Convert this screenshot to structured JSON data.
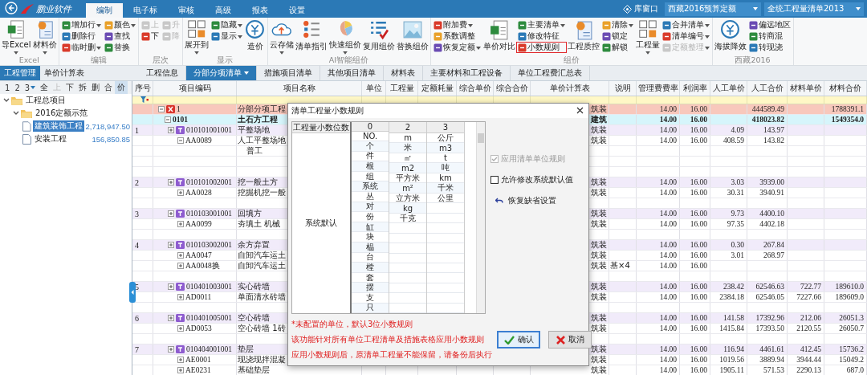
{
  "app": {
    "logo": "鹏业软件",
    "tabs": [
      {
        "label": "编制",
        "selected": true
      },
      {
        "label": "电子标",
        "selected": false
      },
      {
        "label": "审核",
        "selected": false
      },
      {
        "label": "高级",
        "selected": false
      },
      {
        "label": "报表",
        "selected": false
      },
      {
        "label": "设置",
        "selected": false
      }
    ],
    "library_button": "库窗口",
    "quota_select": {
      "value": "西藏2016预算定额"
    },
    "bill_select": {
      "value": "全统工程量清单2013"
    }
  },
  "ribbon": {
    "groups": [
      {
        "label": "Excel",
        "columns": [
          {
            "kind": "large",
            "label": "导Excel",
            "caret": true
          },
          {
            "kind": "large",
            "label": "材料价",
            "caret": true
          }
        ]
      },
      {
        "label": "编辑",
        "columns": [
          {
            "kind": "stack",
            "items": [
              {
                "label": "增加行",
                "caret": true,
                "kind": "normal"
              },
              {
                "label": "删除行",
                "caret": false,
                "kind": "normal"
              },
              {
                "label": "临时删",
                "caret": true,
                "kind": "normal"
              }
            ]
          },
          {
            "kind": "stack",
            "items": [
              {
                "label": "颜色",
                "caret": true,
                "kind": "normal"
              },
              {
                "label": "查找",
                "caret": false,
                "kind": "normal"
              },
              {
                "label": "替换",
                "caret": false,
                "kind": "normal"
              }
            ]
          }
        ]
      },
      {
        "label": "层次",
        "columns": [
          {
            "kind": "stack",
            "items": [
              {
                "label": "上",
                "caret": false,
                "kind": "disabled"
              },
              {
                "label": "下",
                "caret": false,
                "kind": "normal"
              }
            ]
          },
          {
            "kind": "stack",
            "items": [
              {
                "label": "升",
                "caret": false,
                "kind": "disabled"
              },
              {
                "label": "降",
                "caret": false,
                "kind": "disabled"
              }
            ]
          }
        ]
      },
      {
        "label": "显示",
        "columns": [
          {
            "kind": "large",
            "label": "展开到",
            "caret": true
          },
          {
            "kind": "stack",
            "items": [
              {
                "label": "隐藏",
                "caret": true,
                "kind": "normal"
              },
              {
                "label": "显示",
                "caret": true,
                "kind": "normal"
              }
            ]
          },
          {
            "kind": "large",
            "label": "造价",
            "caret": false
          }
        ]
      },
      {
        "label": "AI智能组价",
        "columns": [
          {
            "kind": "large",
            "label": "云存储",
            "caret": true
          },
          {
            "kind": "large",
            "label": "清单指引",
            "caret": false
          },
          {
            "kind": "large",
            "label": "快速组价",
            "caret": true
          },
          {
            "kind": "large",
            "label": "复用组价",
            "caret": false
          },
          {
            "kind": "large",
            "label": "替换组价",
            "caret": false
          }
        ]
      },
      {
        "label": "组价",
        "columns": [
          {
            "kind": "stack",
            "items": [
              {
                "label": "附加费",
                "caret": true,
                "kind": "normal"
              },
              {
                "label": "系数调整",
                "caret": false,
                "kind": "normal"
              },
              {
                "label": "恢复定额",
                "caret": true,
                "kind": "normal"
              }
            ]
          },
          {
            "kind": "large",
            "label": "单价对比",
            "caret": false
          },
          {
            "kind": "stack",
            "items": [
              {
                "label": "主要清单",
                "caret": true,
                "kind": "normal"
              },
              {
                "label": "修改特征",
                "caret": false,
                "kind": "normal"
              },
              {
                "label": "小数规则",
                "caret": false,
                "kind": "marked"
              }
            ]
          },
          {
            "kind": "large",
            "label": "工程质控",
            "caret": false
          },
          {
            "kind": "stack",
            "items": [
              {
                "label": "清除",
                "caret": true,
                "kind": "normal"
              },
              {
                "label": "锁定",
                "caret": false,
                "kind": "normal"
              },
              {
                "label": "解锁",
                "caret": false,
                "kind": "normal"
              }
            ]
          },
          {
            "kind": "large",
            "label": "工程量",
            "caret": true
          },
          {
            "kind": "stack",
            "items": [
              {
                "label": "合并清单",
                "caret": true,
                "kind": "normal"
              },
              {
                "label": "清单编号",
                "caret": true,
                "kind": "normal"
              },
              {
                "label": "定额整理",
                "caret": true,
                "kind": "disabled"
              }
            ]
          }
        ]
      },
      {
        "label": "西藏2016",
        "columns": [
          {
            "kind": "large",
            "label": "海拔降效",
            "caret": false
          },
          {
            "kind": "stack",
            "items": [
              {
                "label": "偏远地区",
                "caret": false,
                "kind": "normal"
              },
              {
                "label": "转商混",
                "caret": false,
                "kind": "normal"
              },
              {
                "label": "转现浇",
                "caret": false,
                "kind": "normal"
              }
            ]
          }
        ]
      }
    ]
  },
  "left_panel": {
    "tabs": [
      {
        "label": "工程管理",
        "selected": true
      },
      {
        "label": "单价计算表",
        "selected": false
      }
    ],
    "toolbar": [
      {
        "label": "1",
        "kind": "normal"
      },
      {
        "label": "2",
        "kind": "normal"
      },
      {
        "label": "3",
        "kind": "dropdown"
      },
      {
        "label": "全",
        "kind": "normal"
      },
      {
        "label": "上",
        "kind": "disabled"
      },
      {
        "label": "下",
        "kind": "normal"
      },
      {
        "label": "拆",
        "kind": "normal"
      },
      {
        "label": "删",
        "kind": "normal"
      },
      {
        "label": "合",
        "kind": "normal"
      },
      {
        "label": "价",
        "kind": "active"
      }
    ],
    "tree": [
      {
        "label": "工程总项目",
        "expanded": true,
        "selected": false,
        "children": [
          {
            "label": "2016定额示范",
            "expanded": true,
            "selected": false,
            "children": [
              {
                "label": "建筑装饰工程",
                "amount": "2,718,947.50",
                "selected": true
              },
              {
                "label": "安装工程",
                "amount": "156,850.85",
                "selected": false
              }
            ]
          }
        ]
      }
    ]
  },
  "main_tabs": [
    {
      "label": "工程信息",
      "selected": false
    },
    {
      "label": "分部分项清单",
      "selected": true
    },
    {
      "label": "措施项目清单",
      "selected": false
    },
    {
      "label": "其他项目清单",
      "selected": false
    },
    {
      "label": "材料表",
      "selected": false
    },
    {
      "label": "主要材料和工程设备",
      "selected": false
    },
    {
      "label": "单位工程费汇总表",
      "selected": false
    }
  ],
  "table": {
    "columns": [
      "序号",
      "项目编码",
      "项目名称",
      "单位",
      "工程量",
      "定额耗量",
      "综合单价",
      "综合合价",
      "单价计算表",
      "说明",
      "管理费费率",
      "利润率",
      "人工单价",
      "人工合价",
      "材料单价",
      "材料合价"
    ],
    "rows": [
      {
        "kind": "section",
        "expanded": true,
        "code": "1",
        "name": "分部分项工程",
        "calc": "筑装",
        "mgmt": "14.00",
        "profit": "16.00",
        "labor_total": "444589.49",
        "mat_total": "1788391.1"
      },
      {
        "kind": "subsection",
        "expanded": true,
        "code": "0101",
        "name": "土石方工程",
        "calc": "建筑",
        "mgmt": "14.00",
        "profit": "16.00",
        "labor_total": "418023.82",
        "mat_total": "1549354.0"
      },
      {
        "kind": "item",
        "expanded": false,
        "seq": "1",
        "code": "010101001001",
        "name": "平整场地",
        "calc": "筑装",
        "mgmt": "14.00",
        "profit": "16.00",
        "labor_unit": "4.09",
        "labor_total": "143.97"
      },
      {
        "kind": "quota",
        "expanded": true,
        "code": "AA0089",
        "name": "人工平整场地",
        "calc": "筑装",
        "mgmt": "14.00",
        "profit": "16.00",
        "labor_unit": "408.59",
        "labor_total": "143.82"
      },
      {
        "kind": "resource",
        "name": "普工"
      },
      {
        "kind": "blank"
      },
      {
        "kind": "blank"
      },
      {
        "kind": "item",
        "expanded": false,
        "seq": "2",
        "code": "010101002001",
        "name": "挖一般土方",
        "calc": "筑装",
        "mgmt": "14.00",
        "profit": "16.00",
        "labor_unit": "3.03",
        "labor_total": "3939.00"
      },
      {
        "kind": "quota",
        "expanded": false,
        "code": "AA0028",
        "name": "挖掘机挖一般",
        "calc": "筑装",
        "mgmt": "14.00",
        "profit": "16.00",
        "labor_unit": "30.31",
        "labor_total": "3940.91"
      },
      {
        "kind": "blank"
      },
      {
        "kind": "item",
        "expanded": false,
        "seq": "3",
        "code": "010103001001",
        "name": "回填方",
        "calc": "筑装",
        "mgmt": "14.00",
        "profit": "16.00",
        "labor_unit": "9.73",
        "labor_total": "4400.10"
      },
      {
        "kind": "quota",
        "expanded": false,
        "code": "AA0099",
        "name": "夯填土 机械",
        "calc": "筑装",
        "mgmt": "14.00",
        "profit": "16.00",
        "labor_unit": "97.35",
        "labor_total": "4402.18"
      },
      {
        "kind": "blank"
      },
      {
        "kind": "item",
        "expanded": false,
        "seq": "4",
        "code": "010103002001",
        "name": "余方弃置",
        "calc": "筑装",
        "mgmt": "14.00",
        "profit": "16.00",
        "labor_unit": "0.30",
        "labor_total": "267.84"
      },
      {
        "kind": "quota",
        "expanded": false,
        "code": "AA0047",
        "name": "自卸汽车运土",
        "calc": "筑装",
        "mgmt": "14.00",
        "profit": "16.00",
        "labor_unit": "3.01",
        "labor_total": "268.97"
      },
      {
        "kind": "quota",
        "expanded": false,
        "code": "AA0048换",
        "name": "自卸汽车运土",
        "calc": "筑装",
        "note": "基×4",
        "mgmt": "14.00",
        "profit": "16.00"
      },
      {
        "kind": "blank"
      },
      {
        "kind": "item",
        "expanded": false,
        "seq": "5",
        "code": "010401003001",
        "name": "实心砖墙",
        "calc": "筑装",
        "mgmt": "14.00",
        "profit": "16.00",
        "labor_unit": "238.42",
        "labor_total": "62546.63",
        "mat_unit": "722.77",
        "mat_total": "189610.0"
      },
      {
        "kind": "quota",
        "expanded": false,
        "code": "AD0011",
        "name": "单面清水砖墙",
        "calc": "筑装",
        "mgmt": "14.00",
        "profit": "16.00",
        "labor_unit": "2384.18",
        "labor_total": "62546.05",
        "mat_unit": "7227.66",
        "mat_total": "189609.0"
      },
      {
        "kind": "blank"
      },
      {
        "kind": "item",
        "expanded": false,
        "seq": "6",
        "code": "010401005001",
        "name": "空心砖墙",
        "calc": "筑装",
        "mgmt": "14.00",
        "profit": "16.00",
        "labor_unit": "141.58",
        "labor_total": "17392.96",
        "mat_unit": "212.06",
        "mat_total": "26051.3"
      },
      {
        "kind": "quota",
        "expanded": false,
        "code": "AD0053",
        "name": "空心砖墙 1砖",
        "calc": "筑装",
        "mgmt": "14.00",
        "profit": "16.00",
        "labor_unit": "1415.84",
        "labor_total": "17393.50",
        "mat_unit": "2120.55",
        "mat_total": "26050.7"
      },
      {
        "kind": "blank"
      },
      {
        "kind": "item",
        "expanded": false,
        "seq": "7",
        "code": "010404001001",
        "name": "垫层",
        "calc": "筑装",
        "mgmt": "14.00",
        "profit": "16.00",
        "labor_unit": "116.94",
        "labor_total": "4461.61",
        "mat_unit": "412.45",
        "mat_total": "15736.2"
      },
      {
        "kind": "quota",
        "expanded": false,
        "code": "AE0001",
        "name": "现浇现拌混凝",
        "calc": "筑装",
        "mgmt": "14.00",
        "profit": "16.00",
        "labor_unit": "1019.56",
        "labor_total": "3889.94",
        "mat_unit": "3944.44",
        "mat_total": "15049.2"
      },
      {
        "kind": "quota",
        "expanded": false,
        "code": "AE0231",
        "name": "基础垫层",
        "calc": "筑装",
        "mgmt": "14.00",
        "profit": "16.00",
        "labor_unit": "1905.11",
        "labor_total": "571.53",
        "mat_unit": "2290.13",
        "mat_total": "687.0"
      },
      {
        "kind": "blank"
      }
    ]
  },
  "dialog": {
    "title": "清单工程量小数规则",
    "corner": "工程量小数位数",
    "row_label": "系统默认",
    "columns": [
      {
        "header": "0",
        "units": [
          "NO.",
          "个",
          "件",
          "根",
          "组",
          "系统",
          "丛",
          "对",
          "份",
          "缸",
          "块",
          "榀",
          "台",
          "樘",
          "套",
          "摆",
          "支",
          "只"
        ]
      },
      {
        "header": "2",
        "units": [
          "m",
          "米",
          "㎡",
          "m2",
          "平方米",
          "m²",
          "立方米",
          "kg",
          "千克"
        ]
      },
      {
        "header": "3",
        "units": [
          "公斤",
          "m3",
          "t",
          "吨",
          "km",
          "千米",
          "公里"
        ]
      }
    ],
    "options": [
      {
        "label": "应用清单单位规则",
        "checked": true,
        "disabled": true
      },
      {
        "label": "允许修改系统默认值",
        "checked": false,
        "disabled": false
      }
    ],
    "restore_link": "恢复缺省设置",
    "notes": [
      "*未配置的单位，默认3位小数规则",
      "该功能针对所有单位工程清单及措施表格应用小数规则",
      "应用小数规则后，原清单工程量不能保留，请备份后执行"
    ],
    "buttons": [
      {
        "label": "确认",
        "kind": "confirm",
        "focused": true
      },
      {
        "label": "取消",
        "kind": "cancel",
        "focused": false
      }
    ]
  }
}
